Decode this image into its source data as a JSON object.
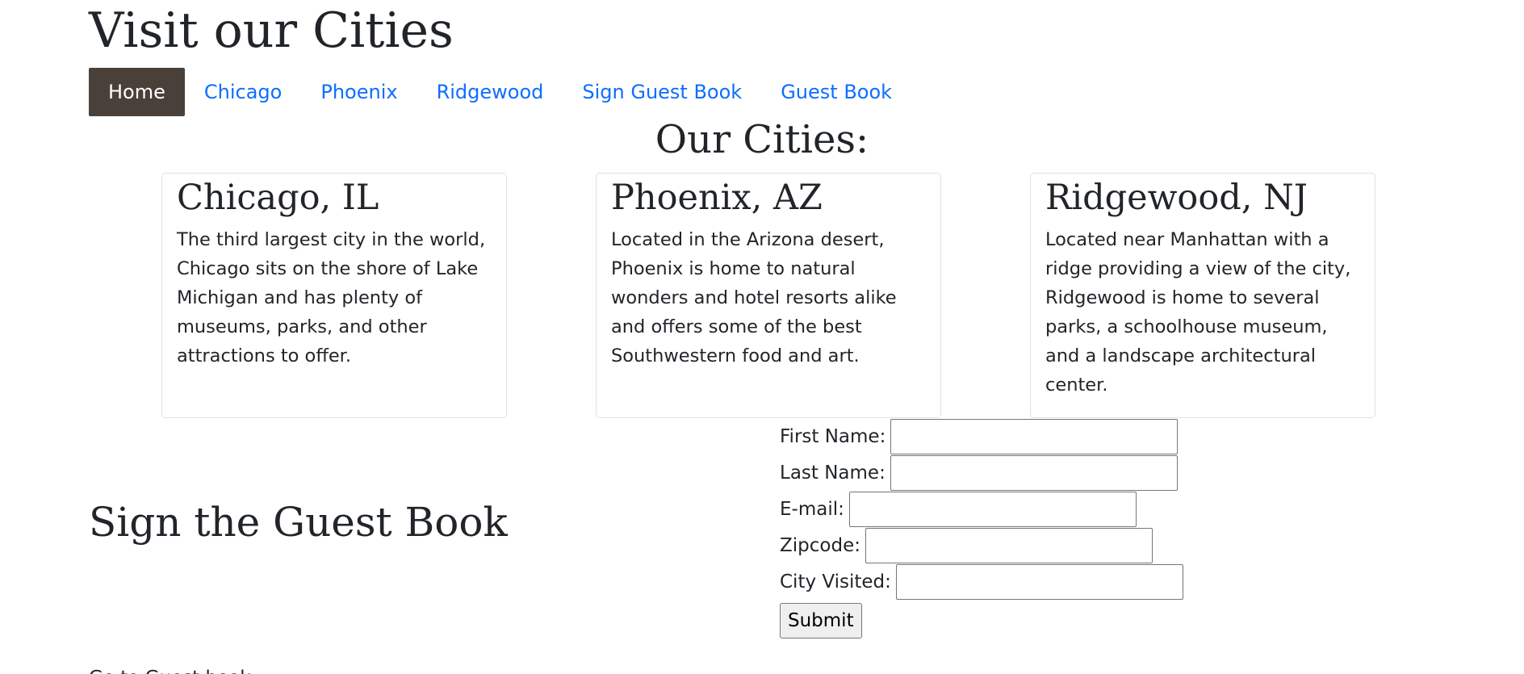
{
  "site": {
    "title": "Visit our Cities"
  },
  "nav": {
    "items": [
      {
        "label": "Home",
        "active": true
      },
      {
        "label": "Chicago",
        "active": false
      },
      {
        "label": "Phoenix",
        "active": false
      },
      {
        "label": "Ridgewood",
        "active": false
      },
      {
        "label": "Sign Guest Book",
        "active": false
      },
      {
        "label": "Guest Book",
        "active": false
      }
    ]
  },
  "cities": {
    "heading": "Our Cities:",
    "cards": [
      {
        "title": "Chicago, IL",
        "text": "The third largest city in the world, Chicago sits on the shore of Lake Michigan and has plenty of museums, parks, and other attractions to offer."
      },
      {
        "title": "Phoenix, AZ",
        "text": "Located in the Arizona desert, Phoenix is home to natural wonders and hotel resorts alike and offers some of the best Southwestern food and art."
      },
      {
        "title": "Ridgewood, NJ",
        "text": "Located near Manhattan with a ridge providing a view of the city, Ridgewood is home to several parks, a schoolhouse museum, and a landscape architectural center."
      }
    ]
  },
  "guestbook": {
    "heading": "Sign the Guest Book",
    "fields": [
      {
        "label": "First Name:",
        "value": ""
      },
      {
        "label": "Last Name:",
        "value": ""
      },
      {
        "label": "E-mail:",
        "value": ""
      },
      {
        "label": "Zipcode:",
        "value": ""
      },
      {
        "label": "City Visited:",
        "value": ""
      }
    ],
    "submit_label": "Submit"
  },
  "footer": {
    "guestbook_link": "Go to Guest book"
  },
  "colors": {
    "nav_active_bg": "#4a403a",
    "link": "#0d6efd",
    "text": "#212529"
  }
}
